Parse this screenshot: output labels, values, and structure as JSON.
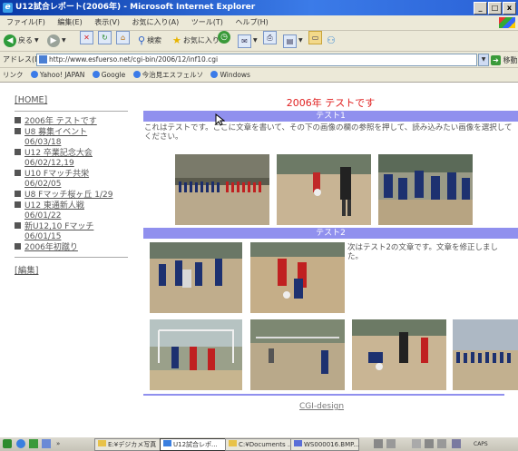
{
  "window": {
    "title": "U12試合レポート(2006年) - Microsoft Internet Explorer",
    "controls": [
      "_",
      "□",
      "x"
    ]
  },
  "menu": {
    "items": [
      "ファイル(F)",
      "編集(E)",
      "表示(V)",
      "お気に入り(A)",
      "ツール(T)",
      "ヘルプ(H)"
    ]
  },
  "toolbar": {
    "back_label": "戻る",
    "search_label": "検索",
    "favorites_label": "お気に入り"
  },
  "address": {
    "label": "アドレス(D)",
    "url": "http://www.esfuerso.net/cgi-bin/2006/12/inf10.cgi",
    "go_label": "移動"
  },
  "links": {
    "label": "リンク",
    "items": [
      "Yahoo! JAPAN",
      "Google",
      "今治見エスフェルソ",
      "Windows"
    ]
  },
  "sidebar": {
    "home_label": "[HOME]",
    "items": [
      {
        "title": "2006年 テストです",
        "date": ""
      },
      {
        "title": "U8 募集イベント",
        "date": "06/03/18"
      },
      {
        "title": "U12 卒業記念大会",
        "date": "06/02/12,19"
      },
      {
        "title": "U10 Fマッチ共栄",
        "date": "06/02/05"
      },
      {
        "title": "U8 Fマッチ桜ヶ丘 1/29",
        "date": ""
      },
      {
        "title": "U12 東通新人戦",
        "date": "06/01/22"
      },
      {
        "title": "新U12,10 Fマッチ",
        "date": "06/01/15"
      },
      {
        "title": "2006年初蹴り",
        "date": ""
      }
    ],
    "edit_label": "[編集]"
  },
  "main": {
    "page_title": "2006年 テストです",
    "section1": {
      "header": "テスト1",
      "text": "これはテストです。ここに文章を書いて、その下の画像の欄の参照を押して、読み込みたい画像を選択してください。"
    },
    "section2": {
      "header": "テスト2",
      "text": "次はテスト2の文章です。文章を修正しました。"
    },
    "footer": "CGI-design"
  },
  "taskbar": {
    "items": [
      "E:¥デジカメ写真",
      "U12試合レポ...",
      "C:¥Documents ...",
      "WS000016.BMP..."
    ],
    "clock": "CAPS"
  },
  "colors": {
    "title_red": "#e02020",
    "section_bar": "#9090ee",
    "ie_titlebar": "#0a3aa6"
  }
}
